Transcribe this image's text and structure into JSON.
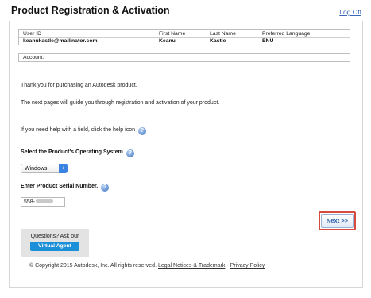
{
  "header": {
    "title": "Product Registration & Activation",
    "logoff_label": "Log Off"
  },
  "user_table": {
    "columns": [
      "User ID",
      "First Name",
      "Last Name",
      "Preferred Language"
    ],
    "values": [
      "keanukastle@mailinator.com",
      "Keanu",
      "Kastle",
      "ENU"
    ]
  },
  "account": {
    "label": "Account:"
  },
  "intro": {
    "thanks": "Thank you for purchasing an Autodesk product.",
    "guide": "The next pages will guide you through registration and activation of your product.",
    "help": "If you need help with a field, click the help icon"
  },
  "os_field": {
    "label": "Select the Product's Operating System",
    "selected": "Windows"
  },
  "serial_field": {
    "label": "Enter Product Serial Number.",
    "value_prefix": "558-"
  },
  "next_button": {
    "label": "Next >>",
    "highlight_color": "#d54b3e"
  },
  "agent": {
    "prompt": "Questions? Ask our",
    "button_label": "Virtual Agent",
    "button_color": "#1b8fd8"
  },
  "footer": {
    "copyright": "© Copyright 2015 Autodesk, Inc. All rights reserved.",
    "legal_link": "Legal Notices & Trademark",
    "separator": "-",
    "privacy_link": "Privacy Policy"
  },
  "icons": {
    "help": "help-icon",
    "dropdown": "chevron-updown-icon"
  }
}
